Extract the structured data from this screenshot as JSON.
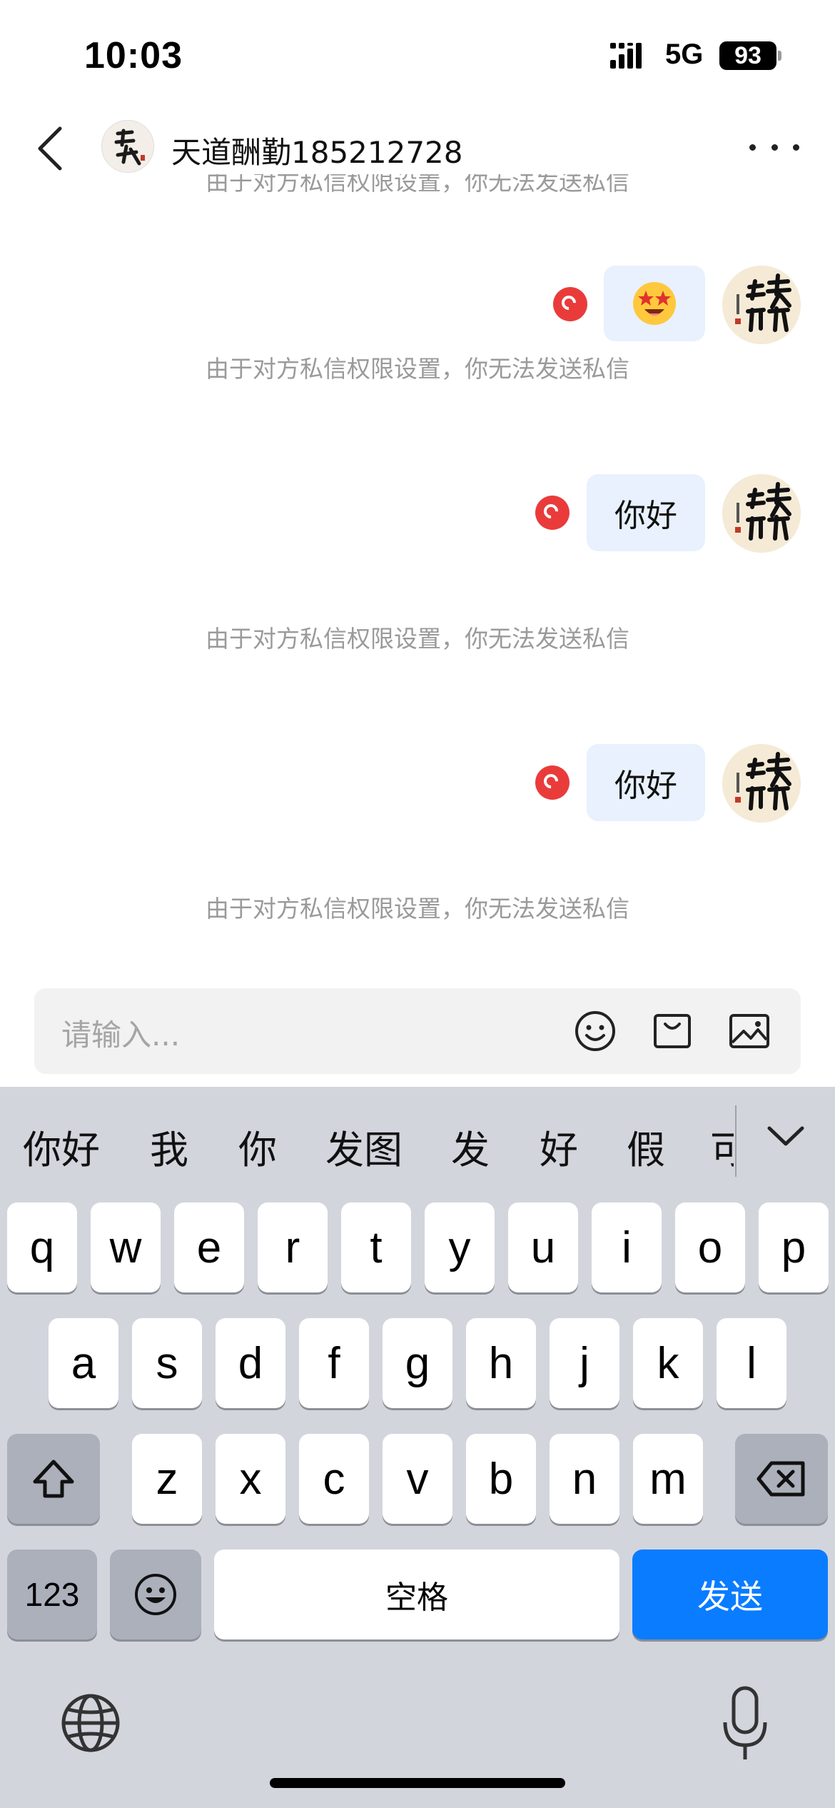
{
  "status_bar": {
    "time": "10:03",
    "network": "5G",
    "battery": "93"
  },
  "header": {
    "peer_name": "天道酬勤185212728"
  },
  "chat": {
    "notice": "由于对方私信权限设置，你无法发送私信",
    "messages": [
      {
        "type": "emoji",
        "content": "😍"
      },
      {
        "type": "text",
        "content": "你好"
      },
      {
        "type": "text",
        "content": "你好"
      }
    ]
  },
  "composer": {
    "placeholder": "请输入..."
  },
  "keyboard": {
    "candidates": [
      "你好",
      "我",
      "你",
      "发图",
      "发",
      "好",
      "假",
      "可"
    ],
    "row1": [
      "q",
      "w",
      "e",
      "r",
      "t",
      "y",
      "u",
      "i",
      "o",
      "p"
    ],
    "row2": [
      "a",
      "s",
      "d",
      "f",
      "g",
      "h",
      "j",
      "k",
      "l"
    ],
    "row3": [
      "z",
      "x",
      "c",
      "v",
      "b",
      "n",
      "m"
    ],
    "num_label": "123",
    "space_label": "空格",
    "send_label": "发送"
  }
}
